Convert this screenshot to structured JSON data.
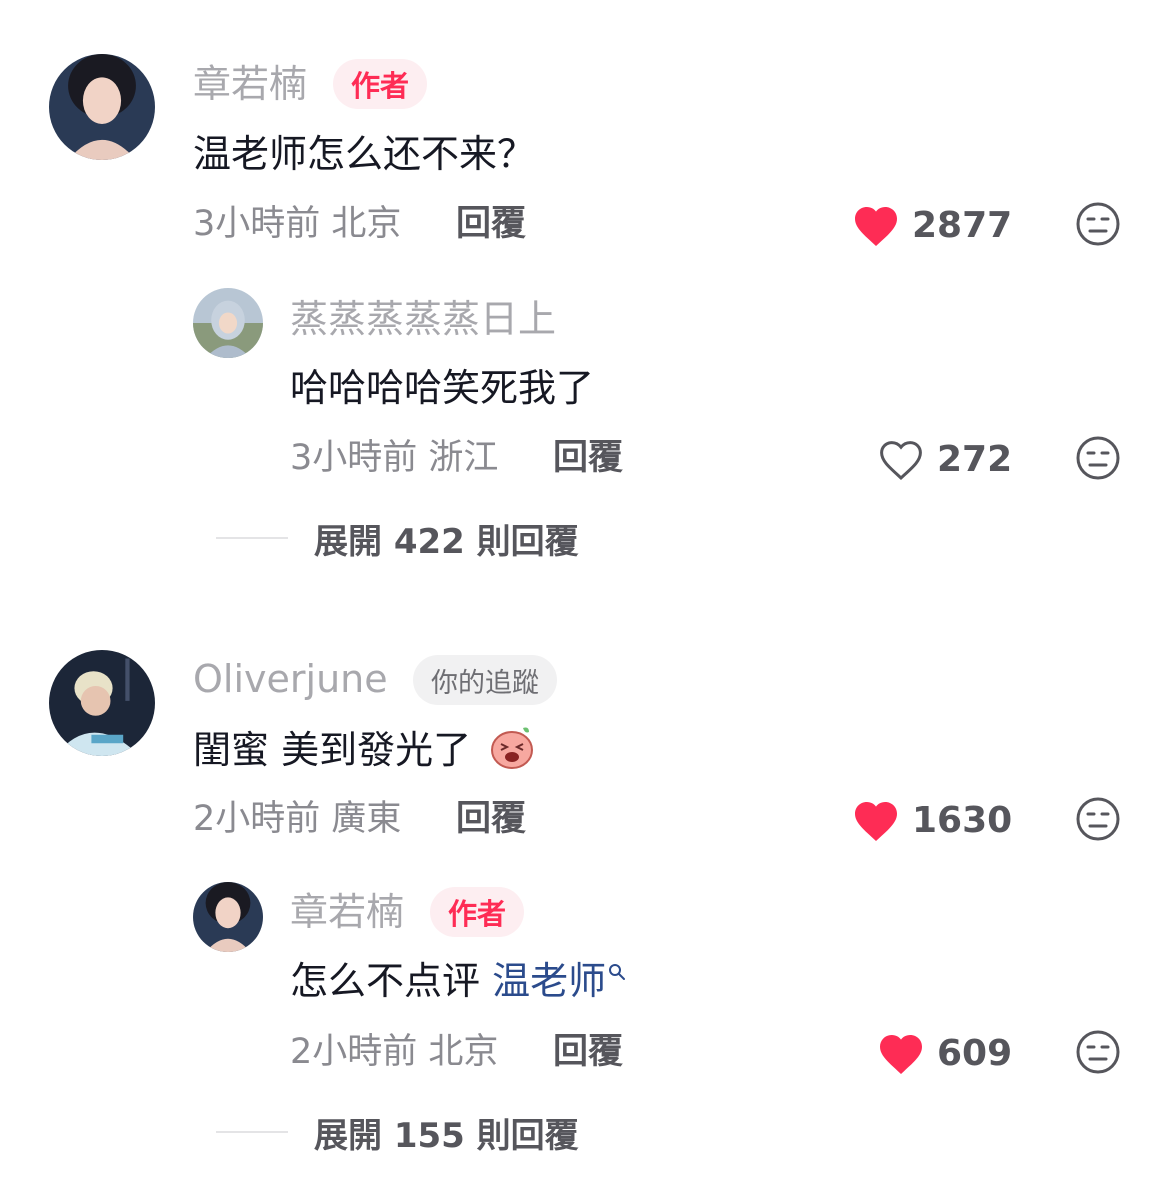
{
  "comments": [
    {
      "username": "章若楠",
      "badge": "作者",
      "text": "温老师怎么还不来？",
      "meta": "3小時前 北京",
      "reply_label": "回覆",
      "like_count": "2877",
      "liked": true,
      "reply": {
        "username": "蒸蒸蒸蒸蒸日上",
        "text": "哈哈哈哈笑死我了",
        "meta": "3小時前 浙江",
        "reply_label": "回覆",
        "like_count": "272",
        "liked": false
      },
      "expand_label": "展開 422 則回覆"
    },
    {
      "username": "Oliverjune",
      "badge": "你的追蹤",
      "text": "閨蜜 美到發光了",
      "meta": "2小時前 廣東",
      "reply_label": "回覆",
      "like_count": "1630",
      "liked": true,
      "reply": {
        "username": "章若楠",
        "badge": "作者",
        "text_prefix": "怎么不点评 ",
        "text_link": "温老师",
        "meta": "2小時前 北京",
        "reply_label": "回覆",
        "like_count": "609",
        "liked": true
      },
      "expand_label": "展開 155 則回覆"
    }
  ],
  "icons": {
    "like": "heart-icon",
    "dislike": "dislike-face-icon",
    "search": "search-icon"
  },
  "colors": {
    "liked_red": "#fe2c55",
    "link_blue": "#2b4b8c"
  }
}
